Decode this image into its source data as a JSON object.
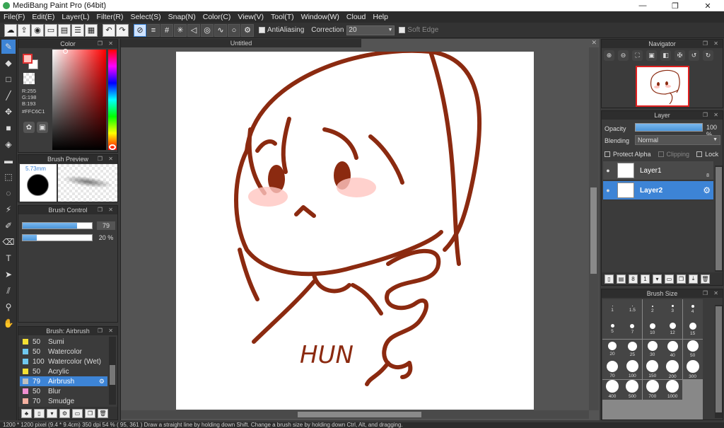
{
  "window": {
    "title": "MediBang Paint Pro (64bit)",
    "minimize": "—",
    "maximize": "❐",
    "close": "✕"
  },
  "menu": [
    "File(F)",
    "Edit(E)",
    "Layer(L)",
    "Filter(R)",
    "Select(S)",
    "Snap(N)",
    "Color(C)",
    "View(V)",
    "Tool(T)",
    "Window(W)",
    "Cloud",
    "Help"
  ],
  "toolbar": {
    "antialias_label": "AntiAliasing",
    "correction_label": "Correction",
    "correction_value": "20",
    "soft_edge_label": "Soft Edge"
  },
  "color_panel": {
    "title": "Color",
    "r": "R:255",
    "g": "G:198",
    "b": "B:193",
    "hex": "#FFC6C1"
  },
  "brush_preview": {
    "title": "Brush Preview",
    "size": "5.73mm"
  },
  "brush_control": {
    "title": "Brush Control",
    "size_value": "79",
    "size_fraction": 0.79,
    "opacity_value": "20 %",
    "opacity_fraction": 0.2
  },
  "brush_list": {
    "title": "Brush: Airbrush",
    "items": [
      {
        "size": "50",
        "name": "Sumi",
        "color": "#f5e033"
      },
      {
        "size": "50",
        "name": "Watercolor",
        "color": "#6fc8f0"
      },
      {
        "size": "100",
        "name": "Watercolor (Wet)",
        "color": "#6fc8f0"
      },
      {
        "size": "50",
        "name": "Acrylic",
        "color": "#f5e033"
      },
      {
        "size": "79",
        "name": "Airbrush",
        "color": "#bfbfbf"
      },
      {
        "size": "50",
        "name": "Blur",
        "color": "#f08fd0"
      },
      {
        "size": "70",
        "name": "Smudge",
        "color": "#f5b0a0"
      }
    ]
  },
  "canvas": {
    "tab_title": "Untitled",
    "drawing_text": "HUN"
  },
  "navigator": {
    "title": "Navigator"
  },
  "layer_panel": {
    "title": "Layer",
    "opacity_label": "Opacity",
    "opacity_value": "100 %",
    "blending_label": "Blending",
    "blending_value": "Normal",
    "protect_alpha": "Protect Alpha",
    "clipping": "Clipping",
    "lock": "Lock",
    "layers": [
      {
        "name": "Layer1",
        "badge": "8"
      },
      {
        "name": "Layer2"
      }
    ]
  },
  "brush_size_panel": {
    "title": "Brush Size",
    "sizes": [
      "1",
      "1.5",
      "2",
      "3",
      "4",
      "5",
      "7",
      "10",
      "12",
      "15",
      "20",
      "25",
      "30",
      "40",
      "50",
      "70",
      "100",
      "150",
      "200",
      "300",
      "400",
      "500",
      "700",
      "1000"
    ]
  },
  "status": "1200 * 1200 pixel  (9.4 * 9.4cm)  350 dpi  54 %  ( 95, 361 )  Draw a straight line by holding down Shift. Change a brush size by holding down Ctrl, Alt, and dragging.",
  "colors": {
    "accent": "#3d84d6",
    "stroke": "#8b2a10",
    "blush": "#ffc6c1"
  }
}
